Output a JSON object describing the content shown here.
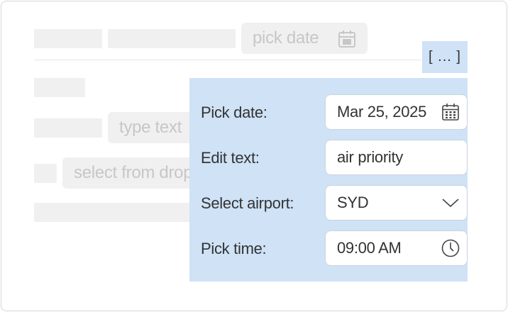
{
  "background_form": {
    "date_placeholder": "pick date",
    "text_placeholder": "type text",
    "dropdown_placeholder": "select from dropdown"
  },
  "more_button": {
    "label": "[ ... ]"
  },
  "popup": {
    "rows": [
      {
        "label": "Pick date:",
        "value": "Mar 25, 2025",
        "icon": "calendar-icon"
      },
      {
        "label": "Edit text:",
        "value": "air priority"
      },
      {
        "label": "Select airport:",
        "value": "SYD",
        "icon": "chevron-down-icon"
      },
      {
        "label": "Pick time:",
        "value": "09:00 AM",
        "icon": "clock-icon"
      }
    ]
  },
  "colors": {
    "popup_background": "#cfe2f6",
    "placeholder_block": "#f0f0f0",
    "placeholder_text": "#c7c7c7",
    "text": "#333333"
  }
}
